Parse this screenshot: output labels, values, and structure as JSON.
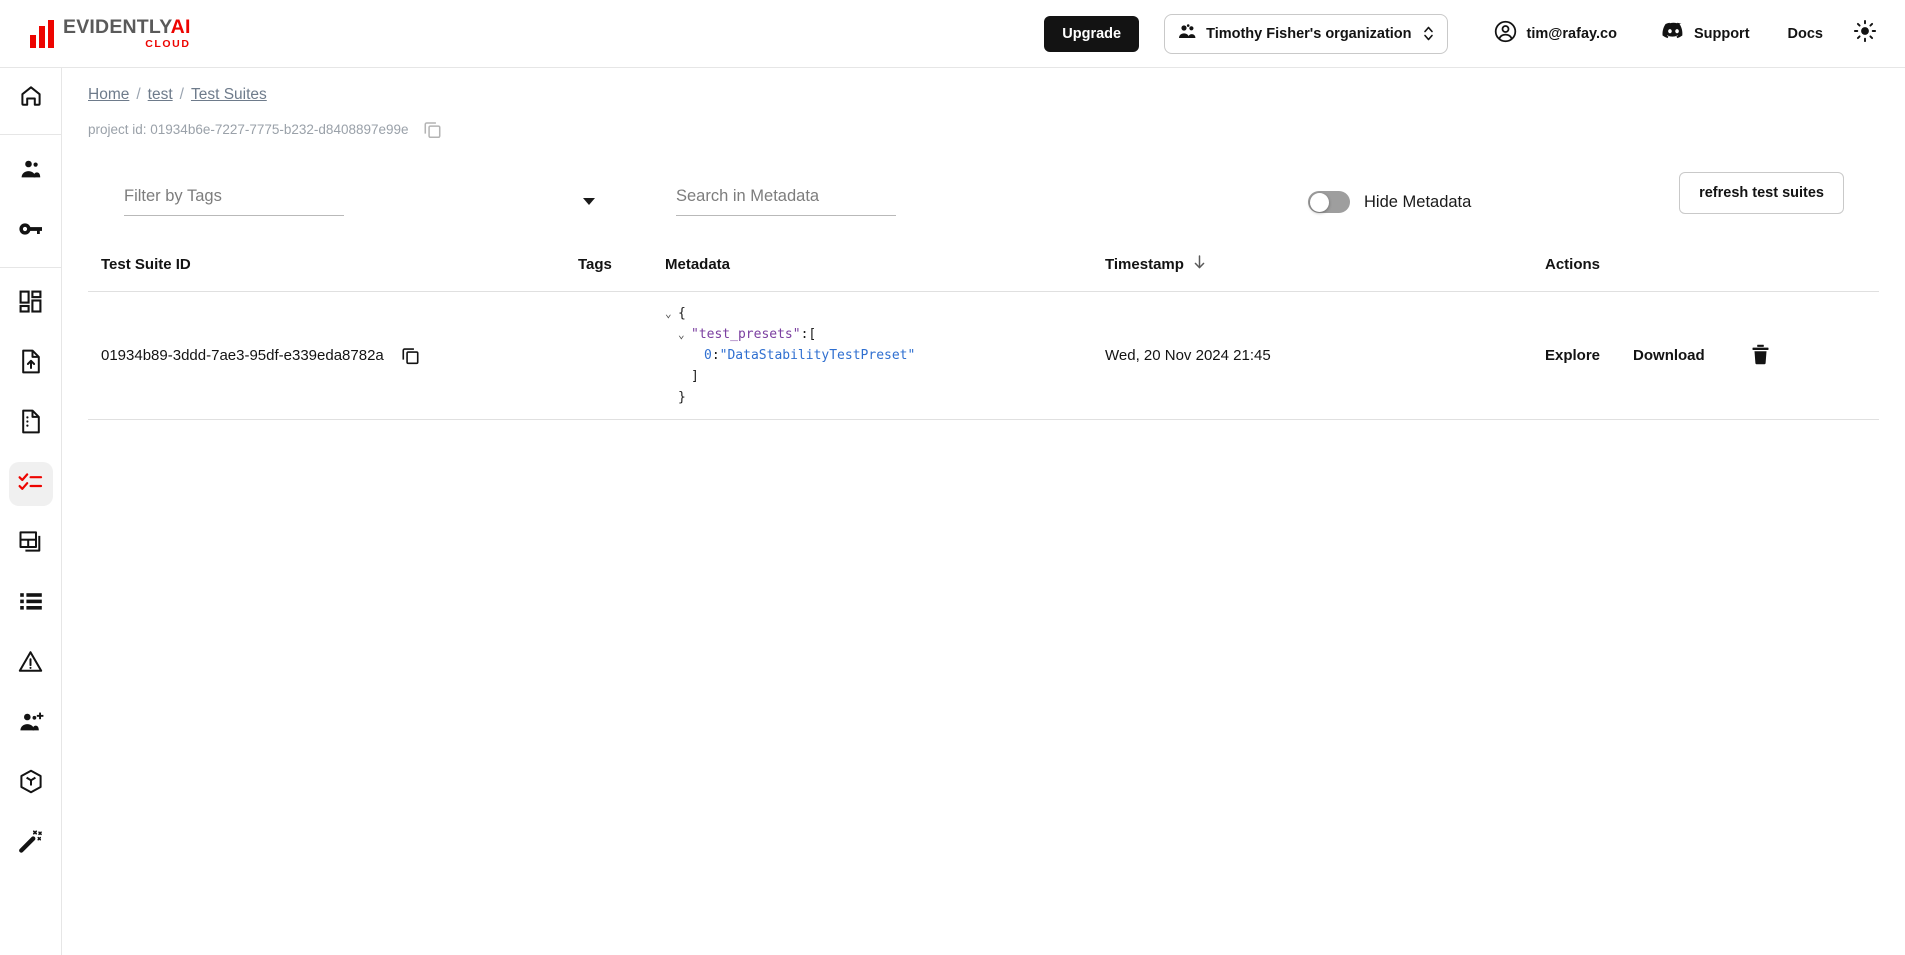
{
  "topbar": {
    "logo": {
      "main": "EVIDENTLY",
      "ai": "AI",
      "sub": "CLOUD",
      "icon": "bar-chart-logo-icon"
    },
    "upgrade_label": "Upgrade",
    "org_name": "Timothy Fisher's organization",
    "org_icon": "people-group-icon",
    "org_spinner_icon": "chevron-updown-icon",
    "account_icon": "account-circle-icon",
    "account_email": "tim@rafay.co",
    "support_icon": "discord-icon",
    "support_label": "Support",
    "docs_label": "Docs",
    "theme_icon": "sun-icon"
  },
  "sidebar": {
    "items": [
      {
        "name": "home",
        "icon": "home-icon",
        "active": false,
        "sep_after": true
      },
      {
        "name": "team",
        "icon": "users-icon",
        "active": false,
        "sep_after": false
      },
      {
        "name": "api-keys",
        "icon": "key-icon",
        "active": false,
        "sep_after": true
      },
      {
        "name": "dashboards",
        "icon": "dashboard-grid-icon",
        "active": false,
        "sep_after": false
      },
      {
        "name": "upload",
        "icon": "file-upload-icon",
        "active": false,
        "sep_after": false
      },
      {
        "name": "reports",
        "icon": "file-lines-icon",
        "active": false,
        "sep_after": false
      },
      {
        "name": "test-suites",
        "icon": "checklist-icon",
        "active": true,
        "sep_after": false
      },
      {
        "name": "snapshots",
        "icon": "panels-icon",
        "active": false,
        "sep_after": false
      },
      {
        "name": "datasets",
        "icon": "list-icon",
        "active": false,
        "sep_after": false
      },
      {
        "name": "alerts",
        "icon": "warning-triangle-icon",
        "active": false,
        "sep_after": false
      },
      {
        "name": "invite-user",
        "icon": "user-plus-icon",
        "active": false,
        "sep_after": false
      },
      {
        "name": "models",
        "icon": "cube-icon",
        "active": false,
        "sep_after": false
      },
      {
        "name": "magic",
        "icon": "magic-wand-icon",
        "active": false,
        "sep_after": false
      }
    ]
  },
  "breadcrumb": {
    "home": "Home",
    "project": "test",
    "current": "Test Suites",
    "separator": "/"
  },
  "project": {
    "id_label": "project id: 01934b6e-7227-7775-b232-d8408897e99e",
    "copy_icon": "copy-icon"
  },
  "toolbar": {
    "tags_placeholder": "Filter by Tags",
    "tags_value": "",
    "search_placeholder": "Search in Metadata",
    "search_value": "",
    "hide_metadata_label": "Hide Metadata",
    "hide_metadata_on": false,
    "refresh_label": "refresh test suites"
  },
  "table": {
    "columns": [
      {
        "key": "id",
        "label": "Test Suite ID"
      },
      {
        "key": "tags",
        "label": "Tags"
      },
      {
        "key": "metadata",
        "label": "Metadata"
      },
      {
        "key": "timestamp",
        "label": "Timestamp",
        "sort_icon": "arrow-down-icon"
      },
      {
        "key": "actions",
        "label": "Actions"
      }
    ],
    "rows": [
      {
        "id": "01934b89-3ddd-7ae3-95df-e339eda8782a",
        "copy_icon": "copy-icon",
        "tags": "",
        "timestamp": "Wed, 20 Nov 2024 21:45",
        "metadata_json": {
          "open_brace": "{",
          "key": "\"test_presets\"",
          "key_colon": ":",
          "open_bracket": "[",
          "index": "0",
          "index_colon": ":",
          "value": "\"DataStabilityTestPreset\"",
          "close_bracket": "]",
          "close_brace": "}",
          "collapse_arrow": "⌄"
        },
        "actions": {
          "explore_label": "Explore",
          "download_label": "Download",
          "delete_icon": "trash-icon"
        }
      }
    ]
  }
}
